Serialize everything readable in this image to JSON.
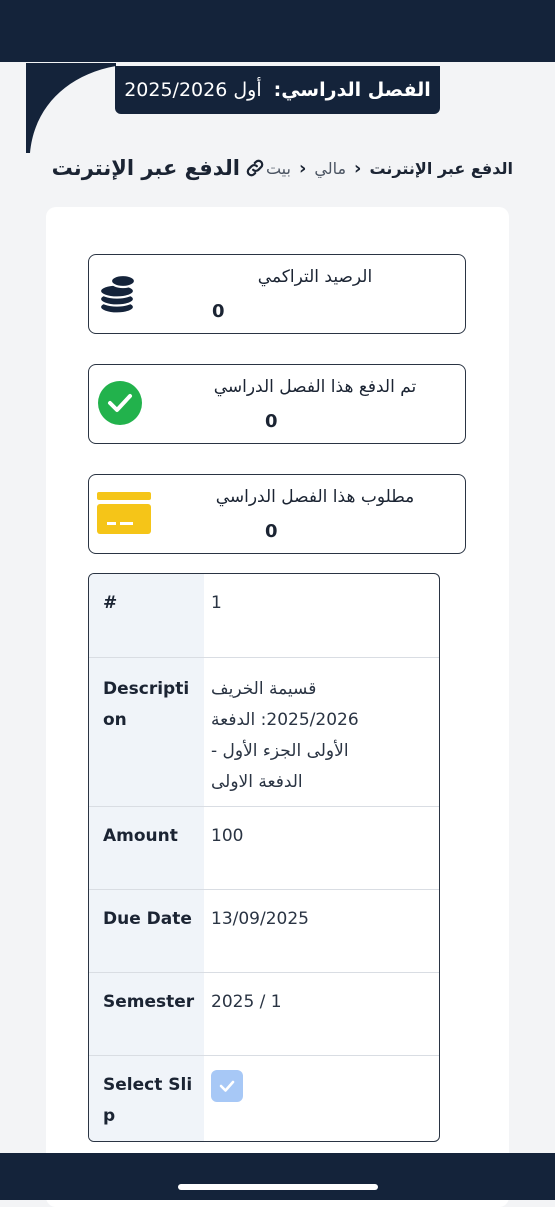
{
  "semester": {
    "label": "الفصل الدراسي:",
    "value": "أول 2025/2026"
  },
  "breadcrumb": {
    "current": "الدفع عبر الإنترنت",
    "items": [
      "مالي",
      "بيت"
    ]
  },
  "page_title": "الدفع عبر الإنترنت",
  "stats": [
    {
      "label": "الرصيد التراكمي",
      "value": "0",
      "icon": "coins-icon",
      "color": "#14233a"
    },
    {
      "label": "تم الدفع هذا الفصل الدراسي",
      "value": "0",
      "icon": "check-circle-icon",
      "color": "#22b24c"
    },
    {
      "label": "مطلوب هذا الفصل الدراسي",
      "value": "0",
      "icon": "credit-card-icon",
      "color": "#f5c518"
    }
  ],
  "table": {
    "rows": [
      {
        "label": "#",
        "value": "1"
      },
      {
        "label": "Description",
        "value": "قسيمة الخريف 2025/2026: الدفعة الأولى الجزء الأول - الدفعة الاولى"
      },
      {
        "label": "Amount",
        "value": "100"
      },
      {
        "label": "Due Date",
        "value": "13/09/2025"
      },
      {
        "label": "Semester",
        "value": "2025 / 1"
      },
      {
        "label": "Select Slip",
        "checked": true
      }
    ]
  },
  "colors": {
    "navy": "#14233a",
    "checkbox": "#a7c8f6",
    "label_column": "#f0f4f9"
  }
}
